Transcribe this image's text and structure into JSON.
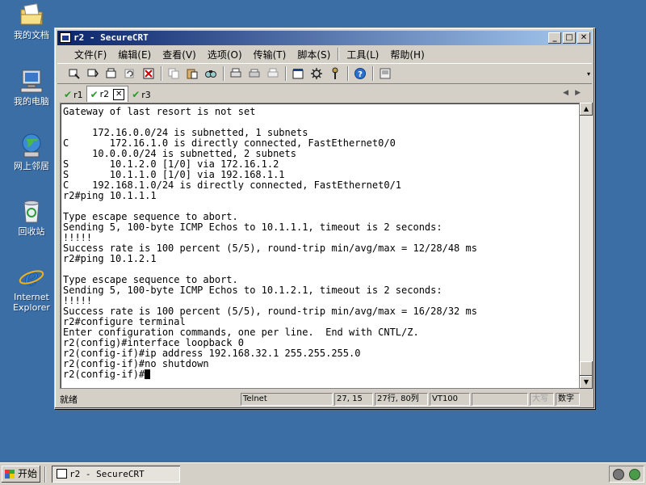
{
  "desktop": {
    "icons": [
      {
        "label": "我的文档"
      },
      {
        "label": "我的电脑"
      },
      {
        "label": "网上邻居"
      },
      {
        "label": "回收站"
      },
      {
        "label": "Internet Explorer"
      }
    ]
  },
  "window": {
    "title": "r2 - SecureCRT",
    "buttons": {
      "minimize": "_",
      "maximize": "□",
      "close": "✕"
    }
  },
  "menu": {
    "items": [
      "文件(F)",
      "编辑(E)",
      "查看(V)",
      "选项(O)",
      "传输(T)",
      "脚本(S)",
      "工具(L)",
      "帮助(H)"
    ]
  },
  "tabs": {
    "items": [
      {
        "label": "r1",
        "status": "✔"
      },
      {
        "label": "r2",
        "status": "✔"
      },
      {
        "label": "r3",
        "status": "✔"
      }
    ],
    "close_glyph": "✕",
    "arrows": "◀▶"
  },
  "terminal": {
    "lines": [
      "Gateway of last resort is not set",
      "",
      "     172.16.0.0/24 is subnetted, 1 subnets",
      "C       172.16.1.0 is directly connected, FastEthernet0/0",
      "     10.0.0.0/24 is subnetted, 2 subnets",
      "S       10.1.2.0 [1/0] via 172.16.1.2",
      "S       10.1.1.0 [1/0] via 192.168.1.1",
      "C    192.168.1.0/24 is directly connected, FastEthernet0/1",
      "r2#ping 10.1.1.1",
      "",
      "Type escape sequence to abort.",
      "Sending 5, 100-byte ICMP Echos to 10.1.1.1, timeout is 2 seconds:",
      "!!!!!",
      "Success rate is 100 percent (5/5), round-trip min/avg/max = 12/28/48 ms",
      "r2#ping 10.1.2.1",
      "",
      "Type escape sequence to abort.",
      "Sending 5, 100-byte ICMP Echos to 10.1.2.1, timeout is 2 seconds:",
      "!!!!!",
      "Success rate is 100 percent (5/5), round-trip min/avg/max = 16/28/32 ms",
      "r2#configure terminal",
      "Enter configuration commands, one per line.  End with CNTL/Z.",
      "r2(config)#interface loopback 0",
      "r2(config-if)#ip address 192.168.32.1 255.255.255.0",
      "r2(config-if)#no shutdown",
      "r2(config-if)#"
    ]
  },
  "statusbar": {
    "status": "就绪",
    "protocol": "Telnet",
    "cursor_pos": "27, 15",
    "size": "27行, 80列",
    "emulation": "VT100",
    "caps": "大写",
    "num": "数字"
  },
  "taskbar": {
    "start_label": "开始",
    "task_label": "r2 - SecureCRT"
  }
}
